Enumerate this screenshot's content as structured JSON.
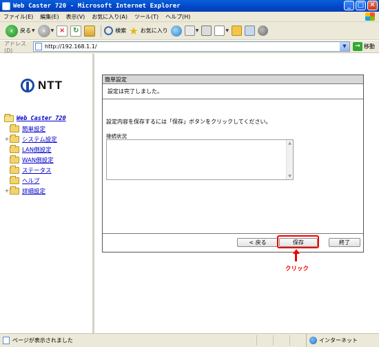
{
  "window": {
    "title": "Web Caster 720 - Microsoft Internet Explorer"
  },
  "menu": [
    "ファイル(E)",
    "編集(E)",
    "表示(V)",
    "お気に入り(A)",
    "ツール(T)",
    "ヘルプ(H)"
  ],
  "toolbar": {
    "back_label": "戻る",
    "search_label": "検索",
    "favorites_label": "お気に入り"
  },
  "address": {
    "label": "アドレス(D)",
    "url": "http://192.168.1.1/",
    "go_label": "移動"
  },
  "brand": {
    "logo_text": "NTT"
  },
  "nav": {
    "root": "Web Caster 720",
    "items": [
      {
        "label": "簡単設定",
        "expander": ""
      },
      {
        "label": "システム設定",
        "expander": "+"
      },
      {
        "label": "LAN側設定",
        "expander": ""
      },
      {
        "label": "WAN側設定",
        "expander": ""
      },
      {
        "label": "ステータス",
        "expander": ""
      },
      {
        "label": "ヘルプ",
        "expander": ""
      },
      {
        "label": "詳細設定",
        "expander": "+"
      }
    ]
  },
  "panel": {
    "title": "簡単設定",
    "done_message": "設定は完了しました。",
    "instruction": "設定内容を保存するには「保存」ボタンをクリックしてください。",
    "status_label": "接続状況",
    "status_value": ""
  },
  "buttons": {
    "back": "< 戻る",
    "save": "保存",
    "finish": "終了"
  },
  "annotation": {
    "click_text": "クリック",
    "color": "#ee0000"
  },
  "statusbar": {
    "text": "ページが表示されました",
    "zone": "インターネット"
  }
}
